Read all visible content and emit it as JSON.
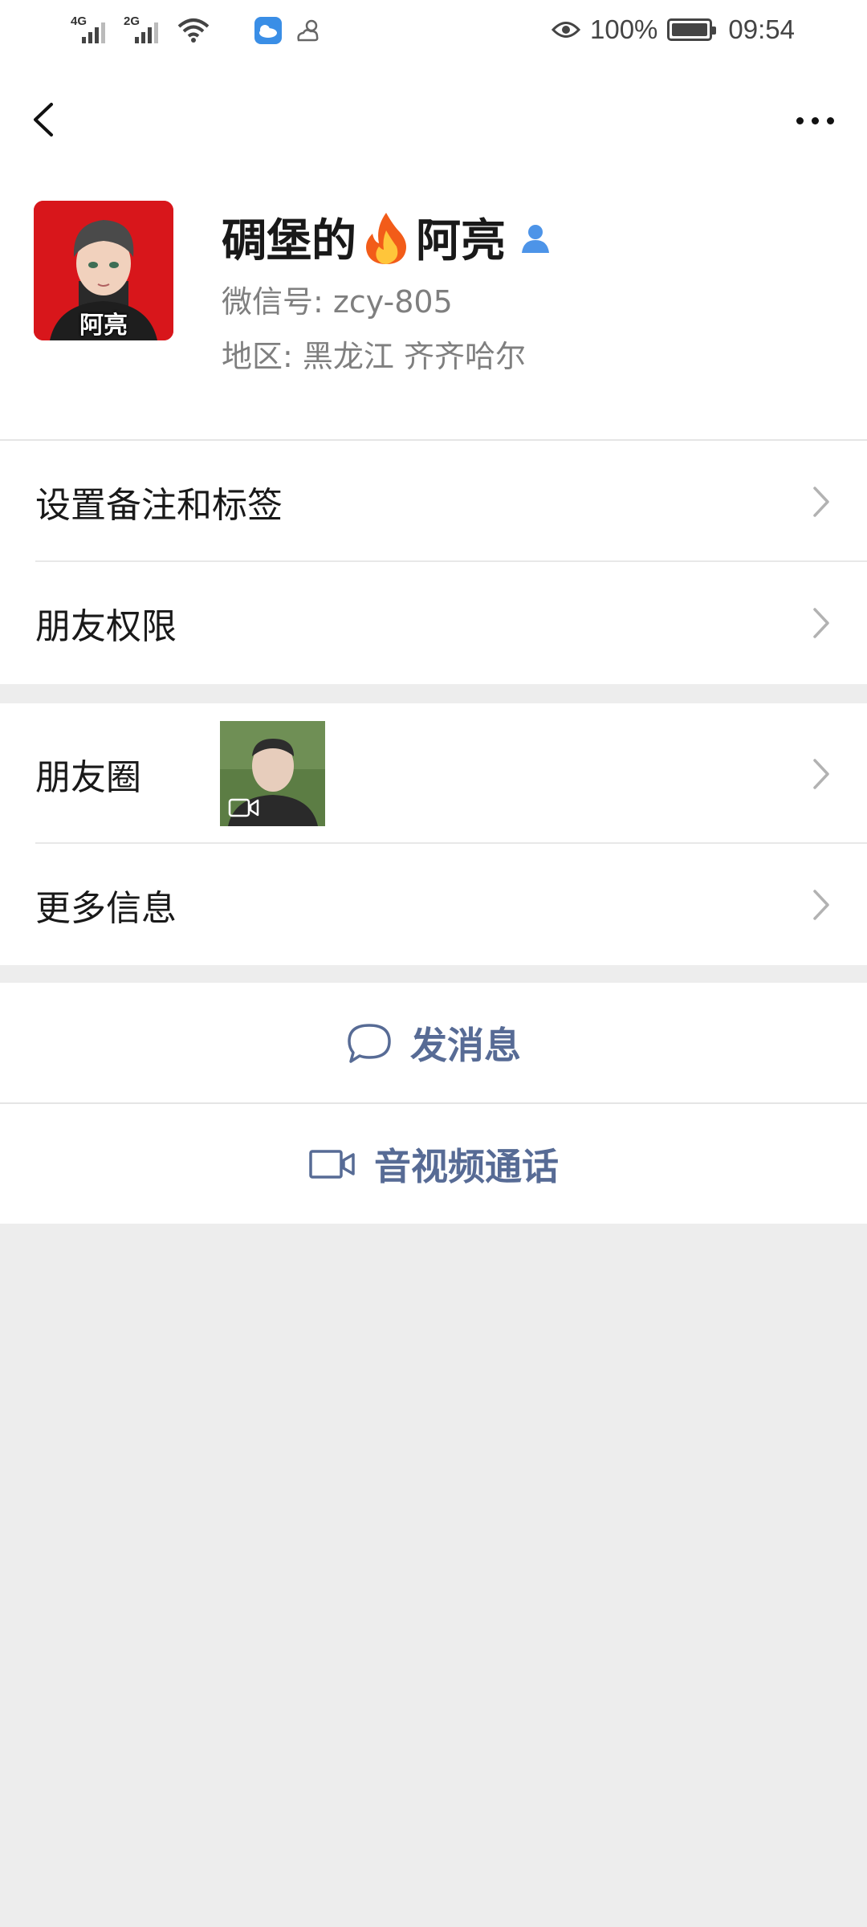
{
  "status_bar": {
    "network_1": "4G",
    "network_2": "2G",
    "battery_percent": "100%",
    "time": "09:54",
    "icons": [
      "signal-icon",
      "signal-icon",
      "wifi-icon",
      "weather-app-icon",
      "partly-cloudy-icon",
      "eye-icon",
      "battery-icon"
    ]
  },
  "header": {
    "back_icon": "back-chevron-icon",
    "more_icon": "more-dots-icon"
  },
  "profile": {
    "nickname_part1": "碉堡的",
    "nickname_emoji": "🔥",
    "nickname_part2": "阿亮",
    "avatar_caption": "阿亮",
    "wechat_id": "微信号: zcy-805",
    "region": "地区: 黑龙江 齐齐哈尔"
  },
  "settings_group": {
    "items": [
      {
        "label": "设置备注和标签"
      },
      {
        "label": "朋友权限"
      }
    ]
  },
  "moments_group": {
    "items": [
      {
        "label": "朋友圈"
      },
      {
        "label": "更多信息"
      }
    ]
  },
  "actions": {
    "send_message": "发消息",
    "av_call": "音视频通话"
  },
  "colors": {
    "link_blue": "#576b95",
    "background_gray": "#ededed",
    "avatar_red": "#d8161b"
  }
}
